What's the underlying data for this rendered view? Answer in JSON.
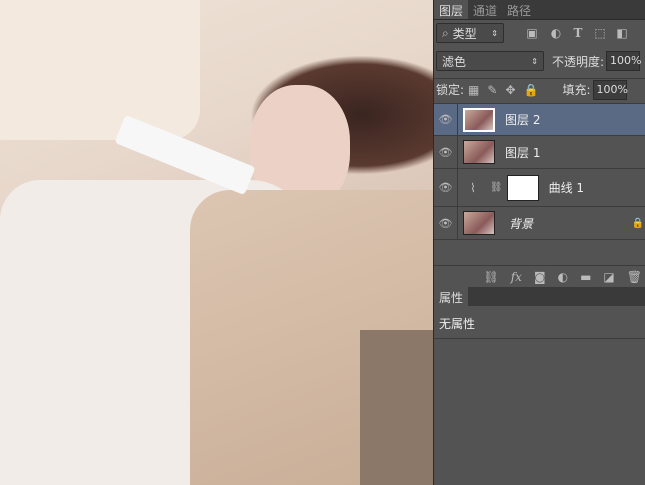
{
  "tabs": [
    "图层",
    "通道",
    "路径"
  ],
  "filter": {
    "label": "类型",
    "icons": [
      "image-filter-icon",
      "adjustment-filter-icon",
      "type-filter-icon",
      "shape-filter-icon",
      "smart-object-filter-icon"
    ]
  },
  "blend": {
    "mode": "滤色",
    "opacity_label": "不透明度:",
    "opacity": "100%"
  },
  "lock": {
    "label": "锁定:",
    "fill_label": "填充:",
    "fill": "100%"
  },
  "layers": [
    {
      "name": "图层 2",
      "selected": true
    },
    {
      "name": "图层 1",
      "selected": false
    },
    {
      "name": "曲线 1",
      "selected": false
    },
    {
      "name": "背景",
      "selected": false
    }
  ],
  "footer": {
    "fx": "fx"
  },
  "properties": {
    "tab": "属性",
    "content": "无属性"
  },
  "colors": {
    "panel": "#535353",
    "selected": "#5a6a84"
  }
}
